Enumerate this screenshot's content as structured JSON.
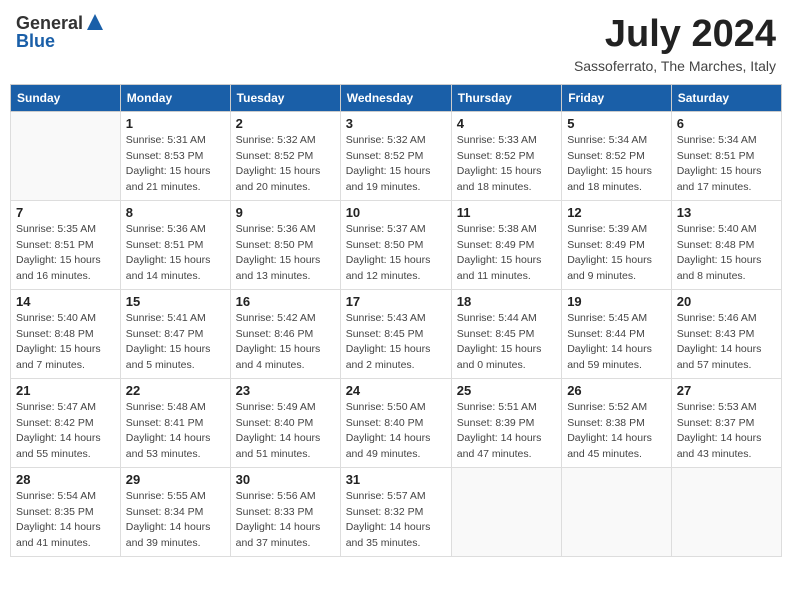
{
  "header": {
    "logo_general": "General",
    "logo_blue": "Blue",
    "month_year": "July 2024",
    "location": "Sassoferrato, The Marches, Italy"
  },
  "days_of_week": [
    "Sunday",
    "Monday",
    "Tuesday",
    "Wednesday",
    "Thursday",
    "Friday",
    "Saturday"
  ],
  "weeks": [
    [
      {
        "day": "",
        "sunrise": "",
        "sunset": "",
        "daylight": ""
      },
      {
        "day": "1",
        "sunrise": "Sunrise: 5:31 AM",
        "sunset": "Sunset: 8:53 PM",
        "daylight": "Daylight: 15 hours and 21 minutes."
      },
      {
        "day": "2",
        "sunrise": "Sunrise: 5:32 AM",
        "sunset": "Sunset: 8:52 PM",
        "daylight": "Daylight: 15 hours and 20 minutes."
      },
      {
        "day": "3",
        "sunrise": "Sunrise: 5:32 AM",
        "sunset": "Sunset: 8:52 PM",
        "daylight": "Daylight: 15 hours and 19 minutes."
      },
      {
        "day": "4",
        "sunrise": "Sunrise: 5:33 AM",
        "sunset": "Sunset: 8:52 PM",
        "daylight": "Daylight: 15 hours and 18 minutes."
      },
      {
        "day": "5",
        "sunrise": "Sunrise: 5:34 AM",
        "sunset": "Sunset: 8:52 PM",
        "daylight": "Daylight: 15 hours and 18 minutes."
      },
      {
        "day": "6",
        "sunrise": "Sunrise: 5:34 AM",
        "sunset": "Sunset: 8:51 PM",
        "daylight": "Daylight: 15 hours and 17 minutes."
      }
    ],
    [
      {
        "day": "7",
        "sunrise": "Sunrise: 5:35 AM",
        "sunset": "Sunset: 8:51 PM",
        "daylight": "Daylight: 15 hours and 16 minutes."
      },
      {
        "day": "8",
        "sunrise": "Sunrise: 5:36 AM",
        "sunset": "Sunset: 8:51 PM",
        "daylight": "Daylight: 15 hours and 14 minutes."
      },
      {
        "day": "9",
        "sunrise": "Sunrise: 5:36 AM",
        "sunset": "Sunset: 8:50 PM",
        "daylight": "Daylight: 15 hours and 13 minutes."
      },
      {
        "day": "10",
        "sunrise": "Sunrise: 5:37 AM",
        "sunset": "Sunset: 8:50 PM",
        "daylight": "Daylight: 15 hours and 12 minutes."
      },
      {
        "day": "11",
        "sunrise": "Sunrise: 5:38 AM",
        "sunset": "Sunset: 8:49 PM",
        "daylight": "Daylight: 15 hours and 11 minutes."
      },
      {
        "day": "12",
        "sunrise": "Sunrise: 5:39 AM",
        "sunset": "Sunset: 8:49 PM",
        "daylight": "Daylight: 15 hours and 9 minutes."
      },
      {
        "day": "13",
        "sunrise": "Sunrise: 5:40 AM",
        "sunset": "Sunset: 8:48 PM",
        "daylight": "Daylight: 15 hours and 8 minutes."
      }
    ],
    [
      {
        "day": "14",
        "sunrise": "Sunrise: 5:40 AM",
        "sunset": "Sunset: 8:48 PM",
        "daylight": "Daylight: 15 hours and 7 minutes."
      },
      {
        "day": "15",
        "sunrise": "Sunrise: 5:41 AM",
        "sunset": "Sunset: 8:47 PM",
        "daylight": "Daylight: 15 hours and 5 minutes."
      },
      {
        "day": "16",
        "sunrise": "Sunrise: 5:42 AM",
        "sunset": "Sunset: 8:46 PM",
        "daylight": "Daylight: 15 hours and 4 minutes."
      },
      {
        "day": "17",
        "sunrise": "Sunrise: 5:43 AM",
        "sunset": "Sunset: 8:45 PM",
        "daylight": "Daylight: 15 hours and 2 minutes."
      },
      {
        "day": "18",
        "sunrise": "Sunrise: 5:44 AM",
        "sunset": "Sunset: 8:45 PM",
        "daylight": "Daylight: 15 hours and 0 minutes."
      },
      {
        "day": "19",
        "sunrise": "Sunrise: 5:45 AM",
        "sunset": "Sunset: 8:44 PM",
        "daylight": "Daylight: 14 hours and 59 minutes."
      },
      {
        "day": "20",
        "sunrise": "Sunrise: 5:46 AM",
        "sunset": "Sunset: 8:43 PM",
        "daylight": "Daylight: 14 hours and 57 minutes."
      }
    ],
    [
      {
        "day": "21",
        "sunrise": "Sunrise: 5:47 AM",
        "sunset": "Sunset: 8:42 PM",
        "daylight": "Daylight: 14 hours and 55 minutes."
      },
      {
        "day": "22",
        "sunrise": "Sunrise: 5:48 AM",
        "sunset": "Sunset: 8:41 PM",
        "daylight": "Daylight: 14 hours and 53 minutes."
      },
      {
        "day": "23",
        "sunrise": "Sunrise: 5:49 AM",
        "sunset": "Sunset: 8:40 PM",
        "daylight": "Daylight: 14 hours and 51 minutes."
      },
      {
        "day": "24",
        "sunrise": "Sunrise: 5:50 AM",
        "sunset": "Sunset: 8:40 PM",
        "daylight": "Daylight: 14 hours and 49 minutes."
      },
      {
        "day": "25",
        "sunrise": "Sunrise: 5:51 AM",
        "sunset": "Sunset: 8:39 PM",
        "daylight": "Daylight: 14 hours and 47 minutes."
      },
      {
        "day": "26",
        "sunrise": "Sunrise: 5:52 AM",
        "sunset": "Sunset: 8:38 PM",
        "daylight": "Daylight: 14 hours and 45 minutes."
      },
      {
        "day": "27",
        "sunrise": "Sunrise: 5:53 AM",
        "sunset": "Sunset: 8:37 PM",
        "daylight": "Daylight: 14 hours and 43 minutes."
      }
    ],
    [
      {
        "day": "28",
        "sunrise": "Sunrise: 5:54 AM",
        "sunset": "Sunset: 8:35 PM",
        "daylight": "Daylight: 14 hours and 41 minutes."
      },
      {
        "day": "29",
        "sunrise": "Sunrise: 5:55 AM",
        "sunset": "Sunset: 8:34 PM",
        "daylight": "Daylight: 14 hours and 39 minutes."
      },
      {
        "day": "30",
        "sunrise": "Sunrise: 5:56 AM",
        "sunset": "Sunset: 8:33 PM",
        "daylight": "Daylight: 14 hours and 37 minutes."
      },
      {
        "day": "31",
        "sunrise": "Sunrise: 5:57 AM",
        "sunset": "Sunset: 8:32 PM",
        "daylight": "Daylight: 14 hours and 35 minutes."
      },
      {
        "day": "",
        "sunrise": "",
        "sunset": "",
        "daylight": ""
      },
      {
        "day": "",
        "sunrise": "",
        "sunset": "",
        "daylight": ""
      },
      {
        "day": "",
        "sunrise": "",
        "sunset": "",
        "daylight": ""
      }
    ]
  ]
}
